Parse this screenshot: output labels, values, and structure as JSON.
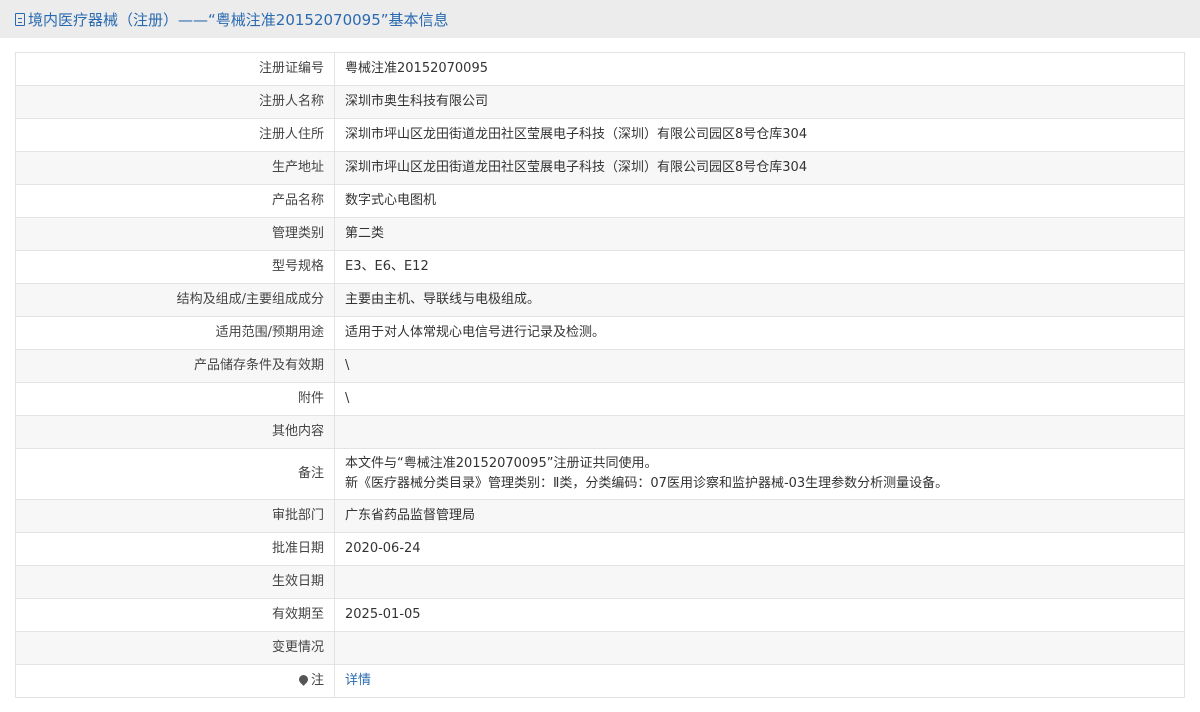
{
  "header": {
    "title": "境内医疗器械（注册）——“粤械注准20152070095”基本信息"
  },
  "rows": [
    {
      "label": "注册证编号",
      "value": "粤械注准20152070095"
    },
    {
      "label": "注册人名称",
      "value": "深圳市奥生科技有限公司"
    },
    {
      "label": "注册人住所",
      "value": "深圳市坪山区龙田街道龙田社区莹展电子科技（深圳）有限公司园区8号仓库304"
    },
    {
      "label": "生产地址",
      "value": "深圳市坪山区龙田街道龙田社区莹展电子科技（深圳）有限公司园区8号仓库304"
    },
    {
      "label": "产品名称",
      "value": "数字式心电图机"
    },
    {
      "label": "管理类别",
      "value": "第二类"
    },
    {
      "label": "型号规格",
      "value": "E3、E6、E12"
    },
    {
      "label": "结构及组成/主要组成成分",
      "value": "主要由主机、导联线与电极组成。"
    },
    {
      "label": "适用范围/预期用途",
      "value": "适用于对人体常规心电信号进行记录及检测。"
    },
    {
      "label": "产品储存条件及有效期",
      "value": "\\"
    },
    {
      "label": "附件",
      "value": "\\"
    },
    {
      "label": "其他内容",
      "value": ""
    },
    {
      "label": "备注",
      "value": "本文件与“粤械注准20152070095”注册证共同使用。",
      "value2": "新《医疗器械分类目录》管理类别：Ⅱ类，分类编码：07医用诊察和监护器械-03生理参数分析测量设备。"
    },
    {
      "label": "审批部门",
      "value": "广东省药品监督管理局"
    },
    {
      "label": "批准日期",
      "value": "2020-06-24"
    },
    {
      "label": "生效日期",
      "value": ""
    },
    {
      "label": "有效期至",
      "value": "2025-01-05"
    },
    {
      "label": "变更情况",
      "value": ""
    },
    {
      "label": "注",
      "value": "详情"
    }
  ]
}
